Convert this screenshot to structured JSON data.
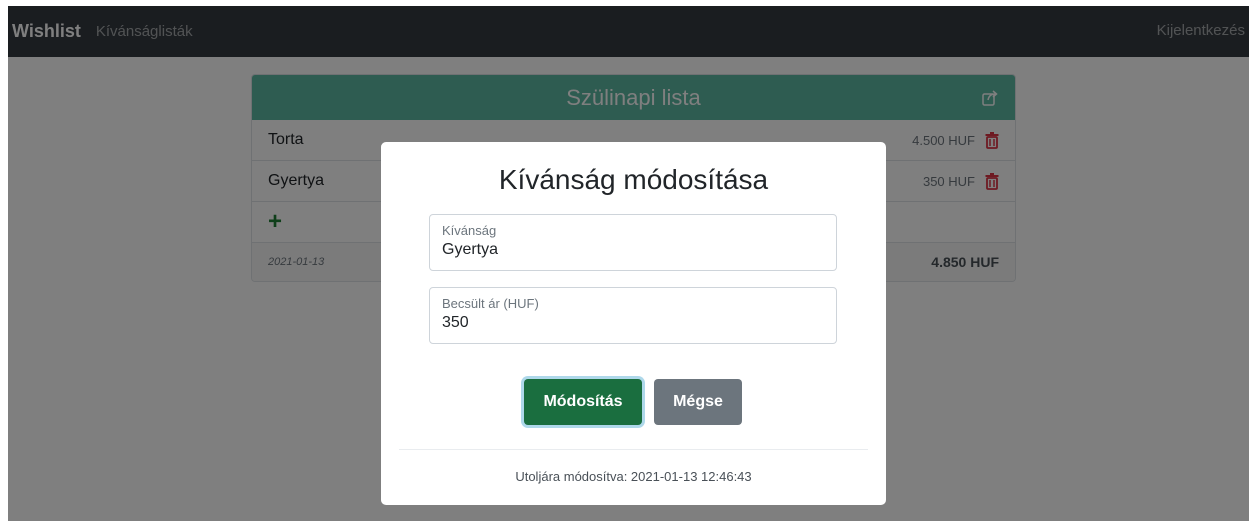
{
  "navbar": {
    "brand": "Wishlist",
    "link": "Kívánságlisták",
    "logout": "Kijelentkezés"
  },
  "list": {
    "title": "Szülinapi lista",
    "items": [
      {
        "name": "Torta",
        "price": "4.500 HUF"
      },
      {
        "name": "Gyertya",
        "price": "350 HUF"
      }
    ],
    "add_label": "+",
    "date": "2021-01-13",
    "total": "4.850 HUF"
  },
  "modal": {
    "title": "Kívánság módosítása",
    "wish_label": "Kívánság",
    "wish_value": "Gyertya",
    "price_label": "Becsült ár (HUF)",
    "price_value": "350",
    "submit_label": "Módosítás",
    "cancel_label": "Mégse",
    "last_modified": "Utoljára módosítva: 2021-01-13 12:46:43"
  },
  "colors": {
    "navbar": "#343a40",
    "header": "#5cb8a3",
    "primary": "#1a6e3f",
    "secondary": "#6c757d",
    "danger": "#dc3545",
    "add": "#1e7e34"
  },
  "icons": {
    "share": "share-icon",
    "delete": "trash-icon"
  }
}
